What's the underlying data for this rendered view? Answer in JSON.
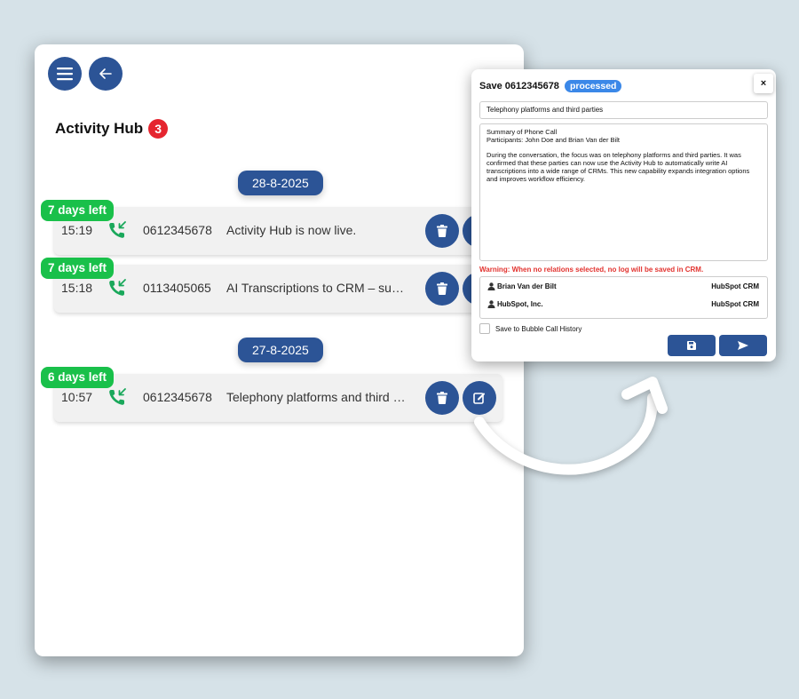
{
  "activity_hub": {
    "title": "Activity Hub",
    "count": "3",
    "groups": [
      {
        "date": "28-8-2025",
        "items": [
          {
            "days_left": "7 days left",
            "time": "15:19",
            "number": "0612345678",
            "subject": "Activity Hub is now live."
          },
          {
            "days_left": "7 days left",
            "time": "15:18",
            "number": "0113405065",
            "subject": "AI Transcriptions to CRM – supports many CRMs"
          }
        ]
      },
      {
        "date": "27-8-2025",
        "items": [
          {
            "days_left": "6 days left",
            "time": "10:57",
            "number": "0612345678",
            "subject": "Telephony platforms and third parties"
          }
        ]
      }
    ]
  },
  "icons": {
    "menu": "menu-icon",
    "back": "arrow-left-icon",
    "call": "incoming-call-icon",
    "delete": "trash-icon",
    "edit": "edit-icon",
    "user": "user-icon",
    "save": "floppy-disk-icon",
    "send": "send-icon",
    "close": "close-icon"
  },
  "modal": {
    "title": "Save 0612345678",
    "status": "processed",
    "close": "×",
    "subject_value": "Telephony platforms and third parties",
    "body": "Summary of Phone Call\nParticipants: John Doe and Brian Van der Bilt\n\nDuring the conversation, the focus was on telephony platforms and third parties. It was confirmed that these parties can now use the Activity Hub to automatically write AI transcriptions into a wide range of CRMs. This new capability expands integration options and improves workflow efficiency.",
    "warning": "Warning: When no relations selected, no log will be saved in CRM.",
    "relations": [
      {
        "name": "Brian Van der Bilt",
        "crm": "HubSpot CRM"
      },
      {
        "name": "HubSpot, Inc.",
        "crm": "HubSpot CRM"
      }
    ],
    "checkbox_label": "Save to Bubble Call History"
  },
  "colors": {
    "primary": "#2c5496",
    "badge_red": "#e5252f",
    "days_green": "#19c04a",
    "call_green": "#1aa85b",
    "processed_blue": "#3b88e8",
    "warning_red": "#e2332f"
  }
}
